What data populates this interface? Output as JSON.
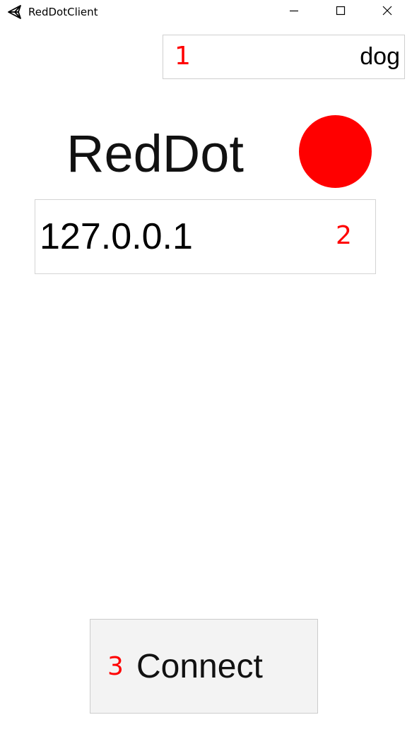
{
  "window": {
    "title": "RedDotClient",
    "app_icon": "unity-icon",
    "controls": {
      "minimize": "minimize-icon",
      "maximize": "maximize-icon",
      "close": "close-icon"
    }
  },
  "name_field": {
    "value": "dog"
  },
  "header": {
    "title": "RedDot",
    "status_dot_color": "#ff0000"
  },
  "ip_field": {
    "value": "127.0.0.1"
  },
  "connect_button": {
    "label": "Connect"
  },
  "annotations": {
    "marker_1": "1",
    "marker_2": "2",
    "marker_3": "3",
    "color": "#ff0000"
  }
}
